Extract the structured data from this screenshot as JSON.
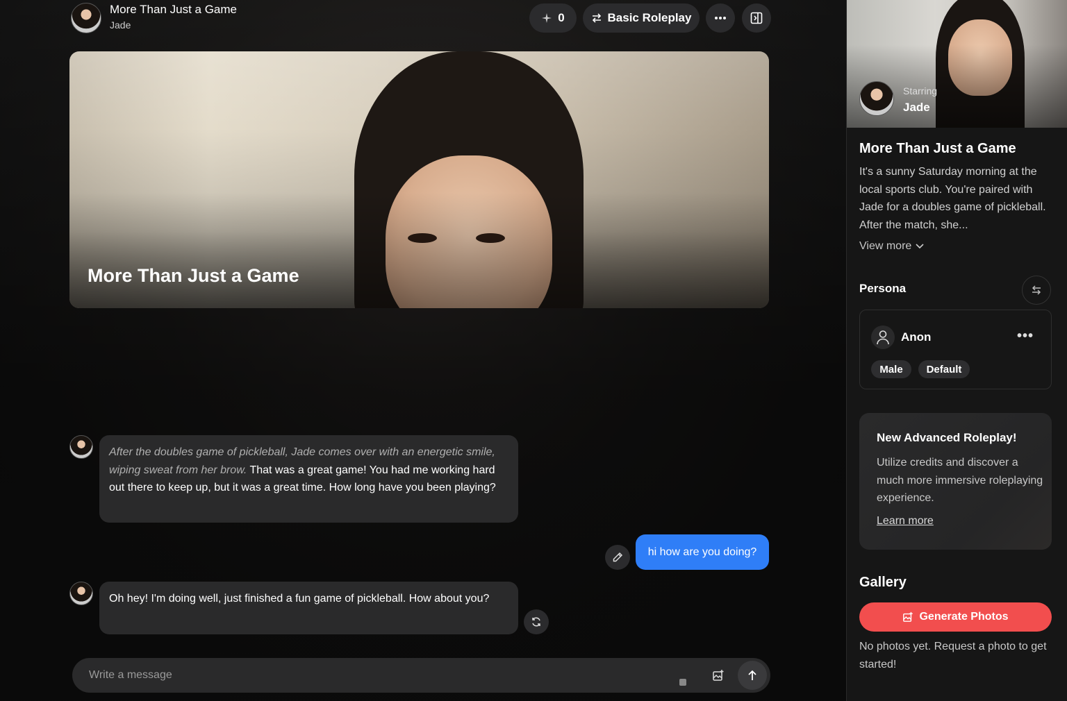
{
  "header": {
    "title": "More Than Just a Game",
    "character": "Jade",
    "credits": "0",
    "mode": "Basic Roleplay"
  },
  "hero": {
    "title": "More Than Just a Game"
  },
  "messages": [
    {
      "role": "character",
      "action": "After the doubles game of pickleball, Jade comes over with an energetic smile, wiping sweat from her brow.",
      "text": " That was a great game! You had me working hard out there to keep up, but it was a great time. How long have you been playing?"
    },
    {
      "role": "user",
      "text": "hi how are you doing?"
    },
    {
      "role": "character",
      "text": "Oh hey! I'm doing well, just finished a fun game of pickleball. How about you?"
    }
  ],
  "composer": {
    "placeholder": "Write a message"
  },
  "sidebar": {
    "starring_label": "Starring",
    "starring_name": "Jade",
    "title": "More Than Just a Game",
    "description": "It's a sunny Saturday morning at the local sports club. You're paired with Jade for a doubles game of pickleball. After the match, she...",
    "view_more": "View more",
    "persona_label": "Persona",
    "persona": {
      "name": "Anon",
      "tags": [
        "Male",
        "Default"
      ]
    },
    "promo": {
      "title": "New Advanced Roleplay!",
      "text": "Utilize credits and discover a much more immersive roleplaying experience.",
      "link": "Learn more"
    },
    "gallery_label": "Gallery",
    "generate_label": "Generate Photos",
    "gallery_empty": "No photos yet. Request a photo to get started!"
  },
  "colors": {
    "user_bubble": "#2f7ef7",
    "generate_button": "#f24e4e",
    "bubble": "#2a2a2b"
  }
}
